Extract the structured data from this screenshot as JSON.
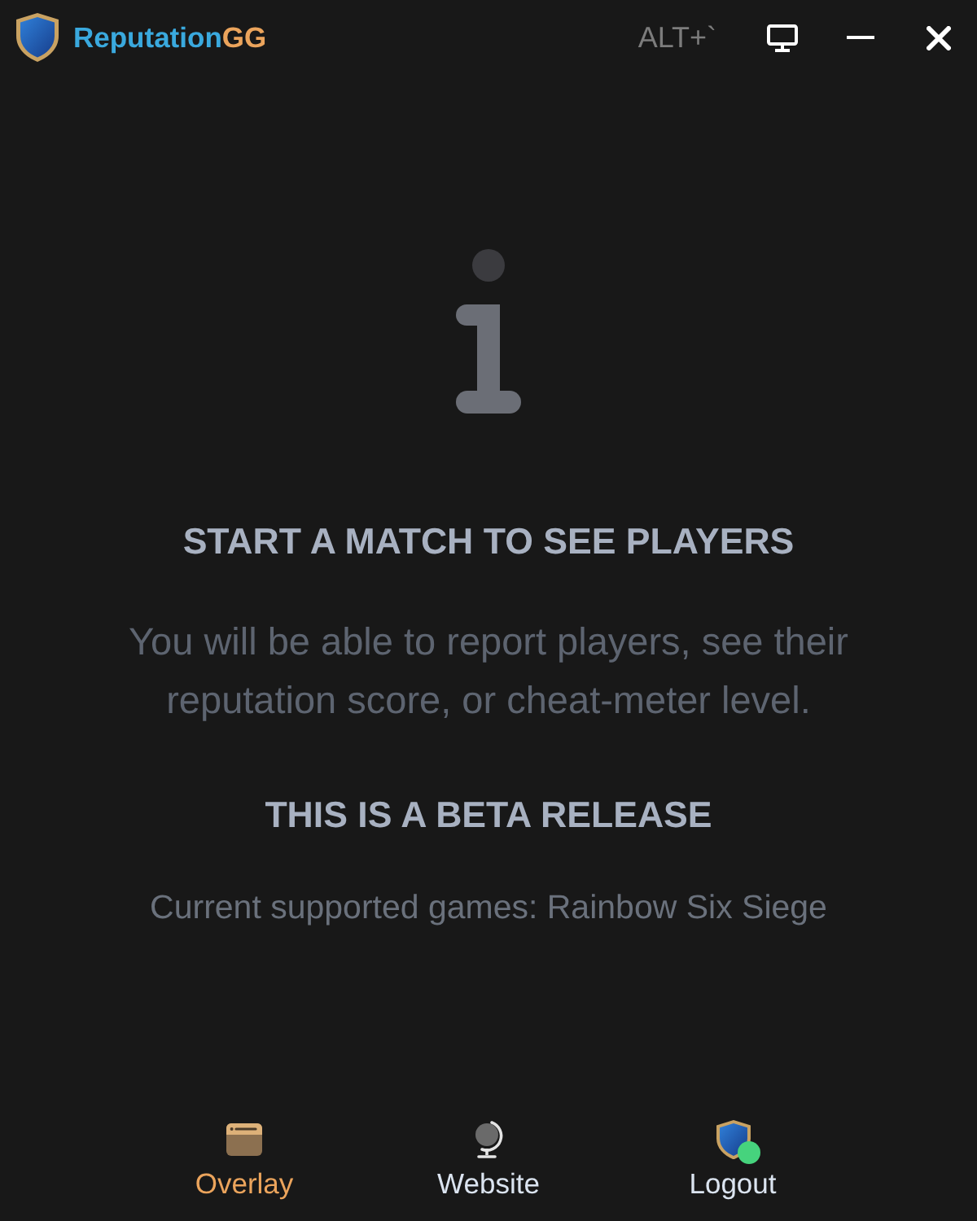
{
  "title_bar": {
    "app_name": "Reputation",
    "app_name_accent": "GG",
    "hotkey": "ALT+`"
  },
  "empty_state": {
    "heading": "START A MATCH TO SEE PLAYERS",
    "message": "You will be able to report players, see their reputation score, or cheat-meter level.",
    "beta_heading": "THIS IS A BETA RELEASE",
    "supported_games": "Current supported games: Rainbow Six Siege"
  },
  "nav": [
    {
      "kind": "overlay",
      "label": "Overlay",
      "selected": true
    },
    {
      "kind": "website",
      "label": "Website",
      "selected": false
    },
    {
      "kind": "logout",
      "label": "Logout",
      "selected": false,
      "online": true
    }
  ]
}
